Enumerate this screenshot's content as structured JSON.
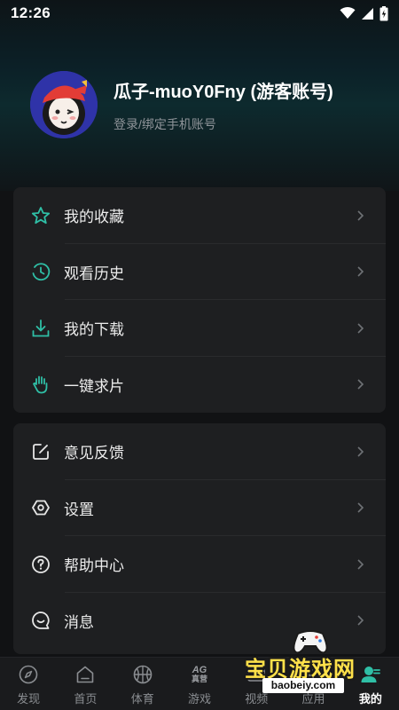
{
  "status_bar": {
    "time": "12:26"
  },
  "profile": {
    "username": "瓜子-muoY0Fny (游客账号)",
    "login_link": "登录/绑定手机账号"
  },
  "menu_group_1": [
    {
      "label": "我的收藏",
      "icon": "star-icon"
    },
    {
      "label": "观看历史",
      "icon": "history-clock-icon"
    },
    {
      "label": "我的下载",
      "icon": "download-icon"
    },
    {
      "label": "一键求片",
      "icon": "hand-icon"
    }
  ],
  "menu_group_2": [
    {
      "label": "意见反馈",
      "icon": "feedback-edit-icon"
    },
    {
      "label": "设置",
      "icon": "settings-hexagon-icon"
    },
    {
      "label": "帮助中心",
      "icon": "help-icon"
    },
    {
      "label": "消息",
      "icon": "message-icon"
    }
  ],
  "bottom_nav": [
    {
      "label": "发现",
      "icon": "compass-icon",
      "active": false
    },
    {
      "label": "首页",
      "icon": "home-icon",
      "active": false
    },
    {
      "label": "体育",
      "icon": "basketball-icon",
      "active": false
    },
    {
      "label": "游戏",
      "icon": "ag-game-icon",
      "active": false
    },
    {
      "label": "视频",
      "icon": "video-icon",
      "active": false
    },
    {
      "label": "应用",
      "icon": "apps-icon",
      "active": false
    },
    {
      "label": "我的",
      "icon": "profile-icon",
      "active": true
    }
  ],
  "game_icon_text": {
    "top": "AG",
    "bottom": "真营"
  },
  "watermark": {
    "title": "宝贝游戏网",
    "url": "baobeiy.com"
  },
  "colors": {
    "accent": "#2fbfa6",
    "card": "#1e1f21",
    "background": "#111214"
  }
}
